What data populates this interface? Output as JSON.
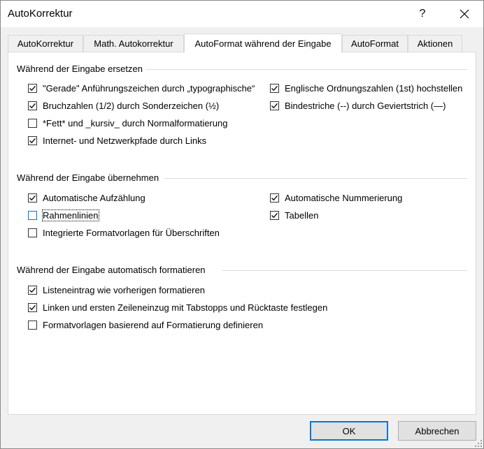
{
  "window": {
    "title": "AutoKorrektur",
    "help_symbol": "?",
    "close_icon": "close-icon"
  },
  "tabs": [
    {
      "label": "AutoKorrektur",
      "active": false
    },
    {
      "label": "Math. Autokorrektur",
      "active": false
    },
    {
      "label": "AutoFormat während der Eingabe",
      "active": true
    },
    {
      "label": "AutoFormat",
      "active": false
    },
    {
      "label": "Aktionen",
      "active": false
    }
  ],
  "groups": {
    "replace": {
      "title": "Während der Eingabe ersetzen",
      "options": [
        {
          "label": "\"Gerade\" Anführungszeichen durch „typographische“",
          "checked": true
        },
        {
          "label": "Englische Ordnungszahlen (1st) hochstellen",
          "checked": true
        },
        {
          "label": "Bruchzahlen (1/2) durch Sonderzeichen (½)",
          "checked": true
        },
        {
          "label": "Bindestriche (--) durch Geviertstrich (—)",
          "checked": true
        },
        {
          "label": "*Fett* und _kursiv_ durch Normalformatierung",
          "checked": false
        },
        {
          "label": "Internet- und Netzwerkpfade durch Links",
          "checked": true
        }
      ]
    },
    "apply": {
      "title": "Während der Eingabe übernehmen",
      "options": [
        {
          "label": "Automatische Aufzählung",
          "checked": true
        },
        {
          "label": "Automatische Nummerierung",
          "checked": true
        },
        {
          "label": "Rahmenlinien",
          "checked": false,
          "focused": true
        },
        {
          "label": "Tabellen",
          "checked": true
        },
        {
          "label": "Integrierte Formatvorlagen für Überschriften",
          "checked": false
        }
      ]
    },
    "format": {
      "title": "Während der Eingabe automatisch formatieren",
      "options": [
        {
          "label": "Listeneintrag wie vorherigen formatieren",
          "checked": true
        },
        {
          "label": "Linken und ersten Zeileneinzug mit Tabstopps und Rücktaste festlegen",
          "checked": true
        },
        {
          "label": "Formatvorlagen basierend auf Formatierung definieren",
          "checked": false
        }
      ]
    }
  },
  "buttons": {
    "ok": "OK",
    "cancel": "Abbrechen"
  },
  "colors": {
    "accent": "#0078d7"
  }
}
